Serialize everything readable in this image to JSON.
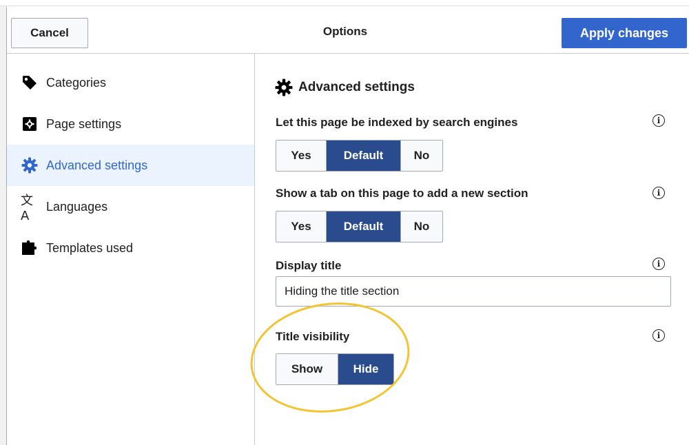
{
  "header": {
    "cancel_label": "Cancel",
    "title": "Options",
    "apply_label": "Apply changes"
  },
  "sidebar": {
    "items": [
      {
        "label": "Categories",
        "icon": "tag-icon"
      },
      {
        "label": "Page settings",
        "icon": "page-settings-icon"
      },
      {
        "label": "Advanced settings",
        "icon": "gear-icon",
        "active": true
      },
      {
        "label": "Languages",
        "icon": "language-icon"
      },
      {
        "label": "Templates used",
        "icon": "puzzle-icon"
      }
    ]
  },
  "content": {
    "section_title": "Advanced settings",
    "index_label": "Let this page be indexed by search engines",
    "index_options": [
      "Yes",
      "Default",
      "No"
    ],
    "index_selected": "Default",
    "newsection_label": "Show a tab on this page to add a new section",
    "newsection_options": [
      "Yes",
      "Default",
      "No"
    ],
    "newsection_selected": "Default",
    "display_title_label": "Display title",
    "display_title_value": "Hiding the title section",
    "title_visibility_label": "Title visibility",
    "title_visibility_options": [
      "Show",
      "Hide"
    ],
    "title_visibility_selected": "Hide",
    "info_glyph": "i"
  },
  "colors": {
    "accent": "#3366cc",
    "selected_toggle": "#2a4b8d",
    "active_nav_bg": "#eaf3ff",
    "highlight_circle": "#f4c430"
  }
}
